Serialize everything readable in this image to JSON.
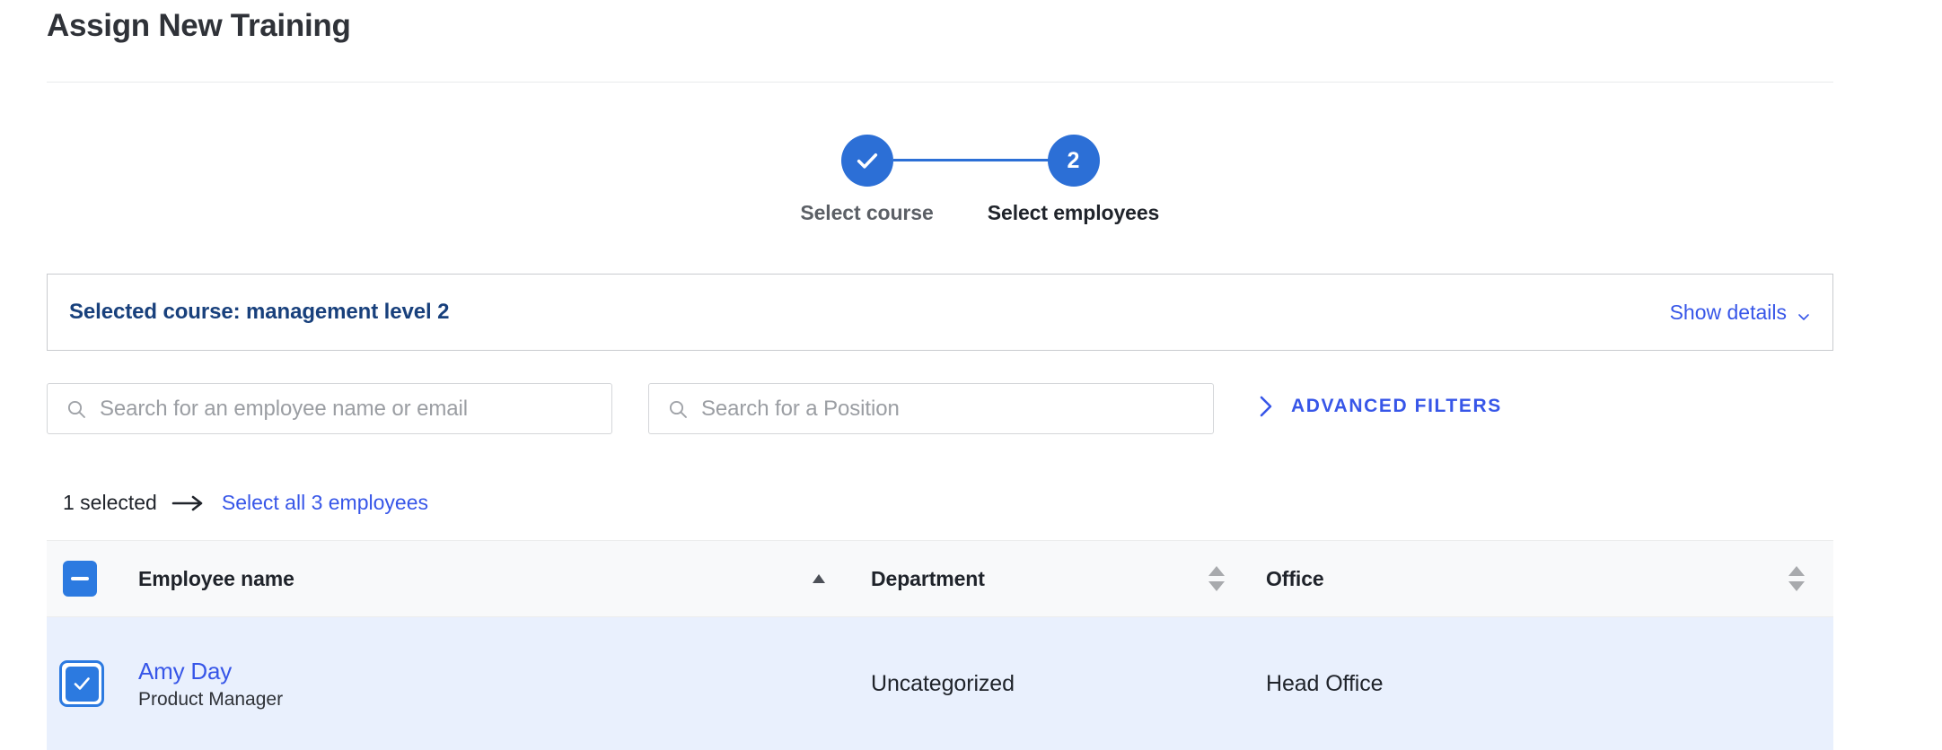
{
  "page": {
    "title": "Assign New Training"
  },
  "stepper": {
    "steps": [
      {
        "label": "Select course",
        "marker": "check-icon",
        "state": "completed"
      },
      {
        "label": "Select employees",
        "marker": "2",
        "state": "active"
      }
    ]
  },
  "course_banner": {
    "title": "Selected course: management level 2",
    "show_details_label": "Show details",
    "chevron_icon": "chevron-down-icon"
  },
  "filters": {
    "employee_search": {
      "icon": "search-icon",
      "value": "",
      "placeholder": "Search for an employee name or email"
    },
    "position_search": {
      "icon": "search-icon",
      "value": "",
      "placeholder": "Search for a Position"
    },
    "advanced_filters": {
      "label": "ADVANCED FILTERS",
      "icon": "chevron-right-icon"
    }
  },
  "selection": {
    "count_label": "1 selected",
    "arrow_icon": "arrow-right-icon",
    "select_all_label": "Select all 3 employees"
  },
  "table": {
    "header_checkbox": {
      "icon": "checkbox-indeterminate-icon",
      "state": "indeterminate"
    },
    "columns": [
      {
        "label": "Employee name",
        "sort": "asc",
        "sort_icon": "sort-ascending-icon"
      },
      {
        "label": "Department",
        "sort": "none",
        "sort_icon": "sort-none-icon"
      },
      {
        "label": "Office",
        "sort": "none",
        "sort_icon": "sort-none-icon"
      }
    ],
    "rows": [
      {
        "checkbox": {
          "icon": "checkbox-checked-icon",
          "state": "checked",
          "focused": true
        },
        "name": "Amy Day",
        "position": "Product Manager",
        "department": "Uncategorized",
        "office": "Head Office",
        "selected": true
      }
    ]
  },
  "colors": {
    "primary_blue": "#2c6fd6",
    "link_blue": "#3756e8",
    "checkbox_blue": "#2c7ae0",
    "banner_title": "#18407c",
    "selected_row_bg": "#e9f0fd",
    "header_row_bg": "#f8f9fa",
    "text_dark": "#20242b",
    "placeholder_gray": "#9b9ea3"
  }
}
